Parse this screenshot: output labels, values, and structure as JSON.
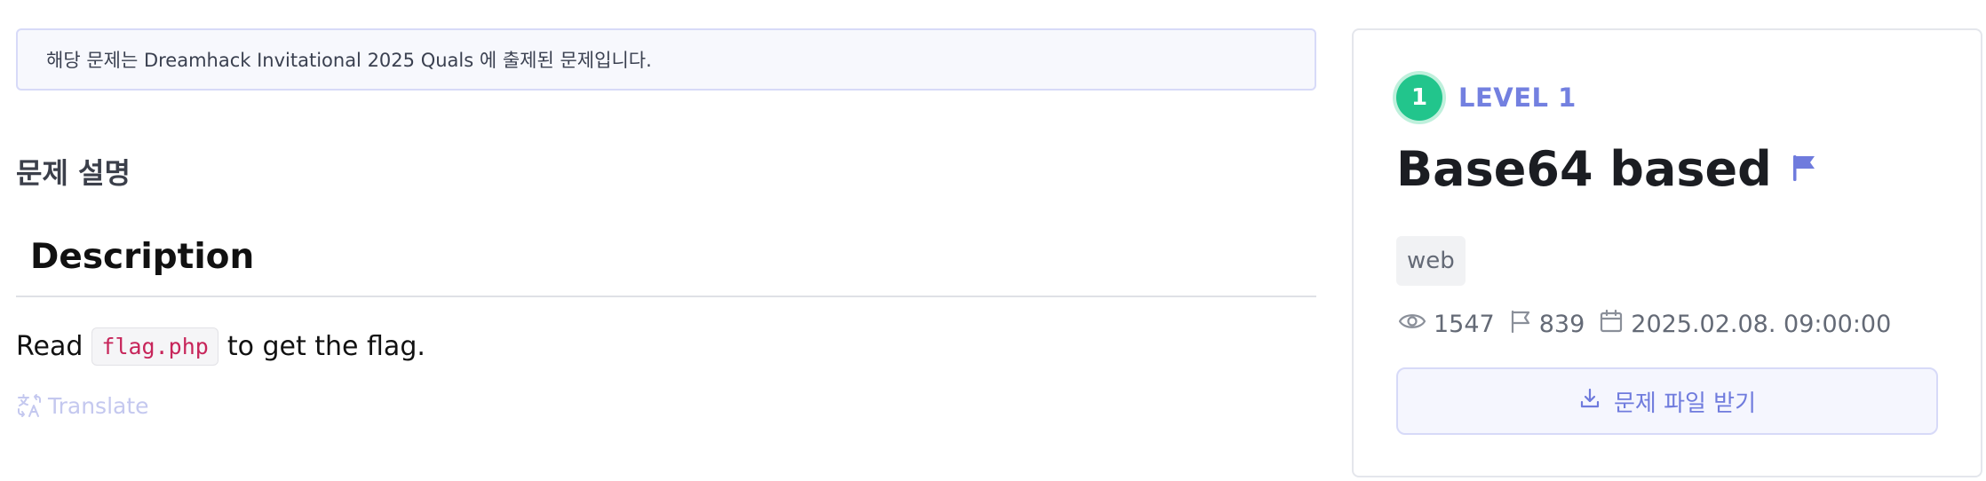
{
  "notice": {
    "text": "해당 문제는 Dreamhack Invitational 2025 Quals 에 출제된 문제입니다."
  },
  "description": {
    "section_title": "문제 설명",
    "heading": "Description",
    "text_before": "Read",
    "code": "flag.php",
    "text_after": "to get the flag.",
    "translate_label": "Translate"
  },
  "challenge": {
    "level_number": "1",
    "level_label": "LEVEL 1",
    "title": "Base64 based",
    "tag": "web",
    "views": "1547",
    "solves": "839",
    "date": "2025.02.08. 09:00:00",
    "download_label": "문제 파일 받기"
  },
  "colors": {
    "accent": "#7380e0",
    "level_green": "#22c58c",
    "code_red": "#c7255a"
  },
  "icons": [
    "translate-icon",
    "flag-icon",
    "eye-icon",
    "flag-outline-icon",
    "calendar-icon",
    "download-icon"
  ]
}
